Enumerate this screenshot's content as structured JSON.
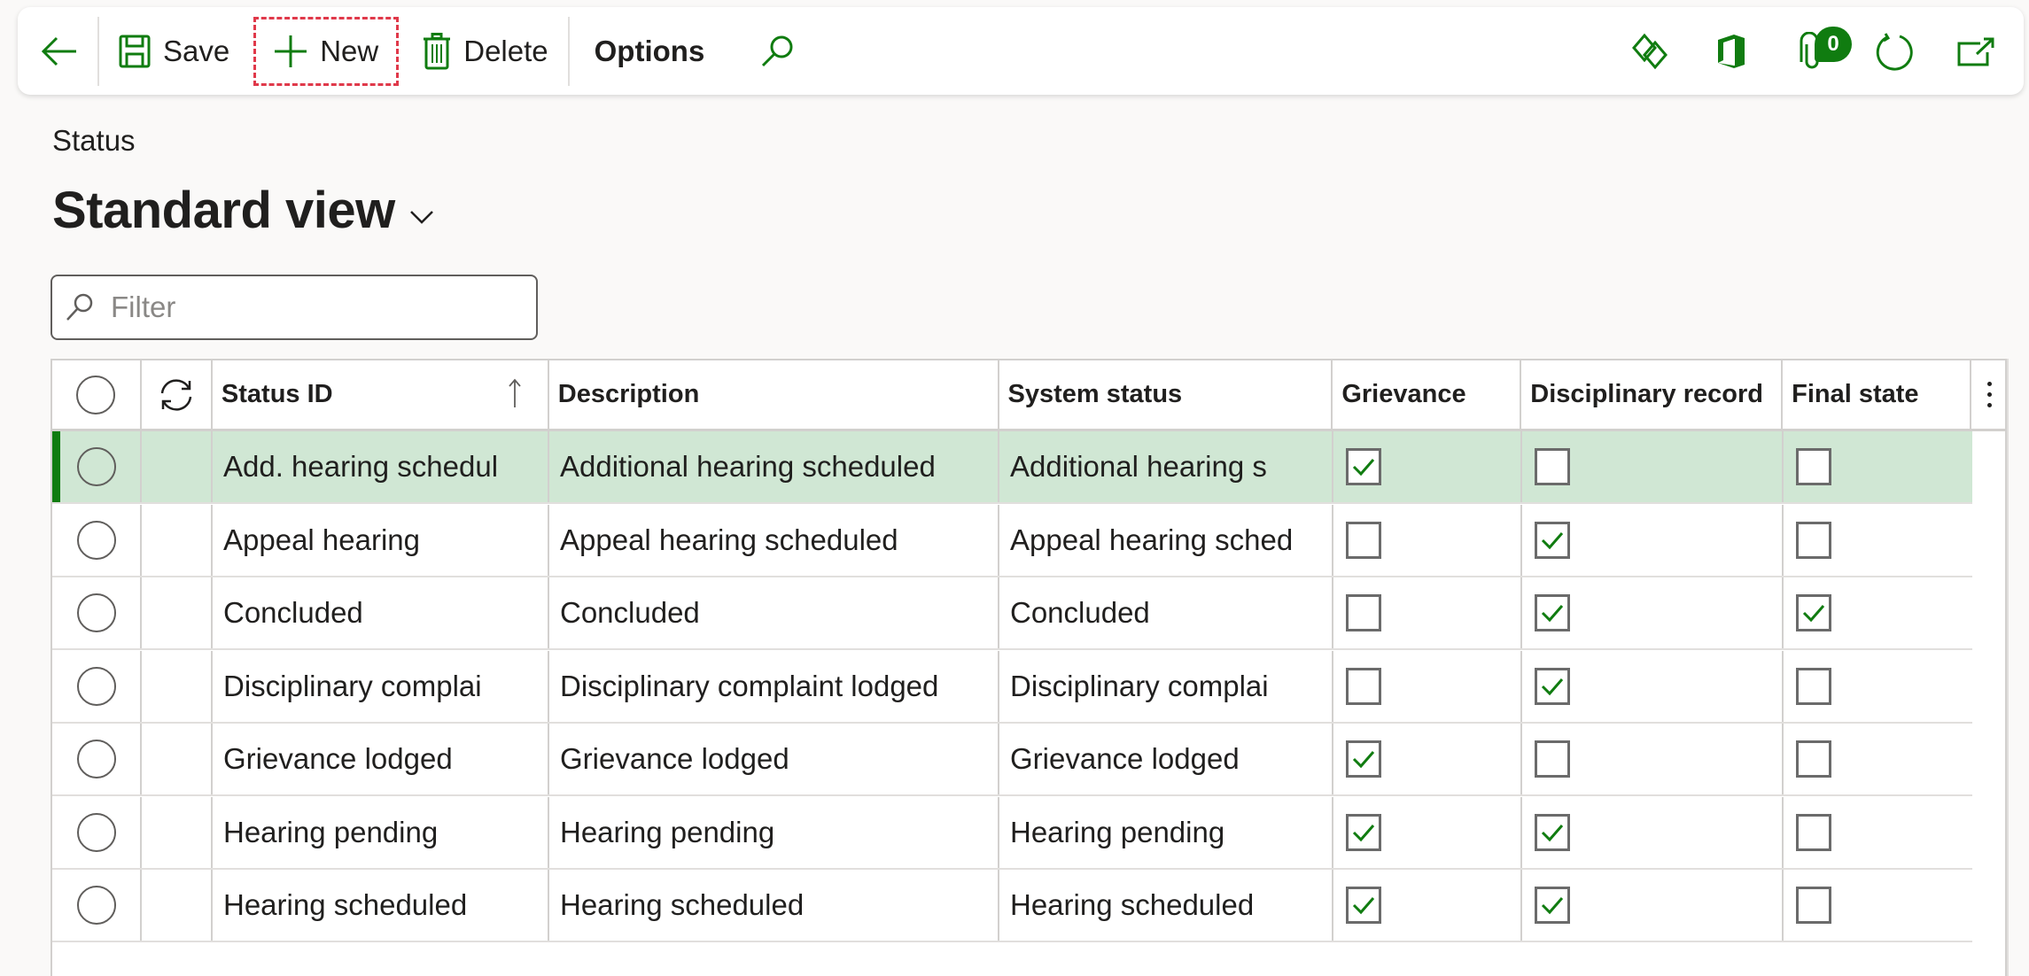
{
  "toolbar": {
    "back_label": "Back",
    "save_label": "Save",
    "new_label": "New",
    "delete_label": "Delete",
    "options_label": "Options",
    "search_label": "Search",
    "right_icons": [
      "power-apps-icon",
      "office-icon",
      "attachments-icon",
      "refresh-icon",
      "open-new-window-icon"
    ],
    "attachments_count": "0"
  },
  "page": {
    "caption": "Status",
    "view_title": "Standard view"
  },
  "filter": {
    "placeholder": "Filter",
    "value": ""
  },
  "grid": {
    "columns": [
      "Status ID",
      "Description",
      "System status",
      "Grievance",
      "Disciplinary record",
      "Final state"
    ],
    "sort": {
      "column": "Status ID",
      "direction": "ascending"
    },
    "rows": [
      {
        "status_id": "Add. hearing schedul",
        "description": "Additional hearing scheduled",
        "system_status": "Additional hearing s",
        "grievance": true,
        "disciplinary_record": false,
        "final_state": false,
        "selected": true
      },
      {
        "status_id": "Appeal hearing",
        "description": "Appeal hearing scheduled",
        "system_status": "Appeal hearing sched",
        "grievance": false,
        "disciplinary_record": true,
        "final_state": false,
        "selected": false
      },
      {
        "status_id": "Concluded",
        "description": "Concluded",
        "system_status": "Concluded",
        "grievance": false,
        "disciplinary_record": true,
        "final_state": true,
        "selected": false
      },
      {
        "status_id": "Disciplinary complai",
        "description": "Disciplinary complaint lodged",
        "system_status": "Disciplinary complai",
        "grievance": false,
        "disciplinary_record": true,
        "final_state": false,
        "selected": false
      },
      {
        "status_id": "Grievance lodged",
        "description": "Grievance lodged",
        "system_status": "Grievance lodged",
        "grievance": true,
        "disciplinary_record": false,
        "final_state": false,
        "selected": false
      },
      {
        "status_id": "Hearing pending",
        "description": "Hearing pending",
        "system_status": "Hearing pending",
        "grievance": true,
        "disciplinary_record": true,
        "final_state": false,
        "selected": false
      },
      {
        "status_id": "Hearing scheduled",
        "description": "Hearing scheduled",
        "system_status": "Hearing scheduled",
        "grievance": true,
        "disciplinary_record": true,
        "final_state": false,
        "selected": false
      }
    ]
  },
  "colors": {
    "accent": "#107c10",
    "selected_row": "#d0e7d4",
    "highlight_outline": "#e0394a"
  }
}
